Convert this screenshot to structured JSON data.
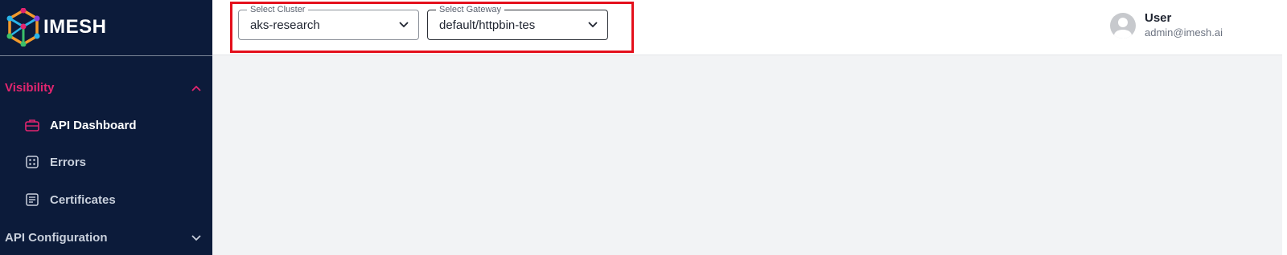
{
  "sidebar": {
    "logo_text": "IMESH",
    "sections": {
      "visibility": "Visibility",
      "api_configuration": "API Configuration"
    },
    "items": [
      {
        "label": "API Dashboard",
        "icon": "briefcase-icon",
        "active": true
      },
      {
        "label": "Errors",
        "icon": "dice-icon",
        "active": false
      },
      {
        "label": "Certificates",
        "icon": "document-icon",
        "active": false
      }
    ]
  },
  "header": {
    "cluster_select": {
      "legend": "Select Cluster",
      "value": "aks-research"
    },
    "gateway_select": {
      "legend": "Select Gateway",
      "value": "default/httpbin-tes"
    },
    "user": {
      "name": "User",
      "email": "admin@imesh.ai"
    }
  },
  "colors": {
    "sidebar_bg": "#0c1b3a",
    "accent": "#e2256f",
    "highlight_border": "#e4101c",
    "content_bg": "#f2f3f5"
  }
}
